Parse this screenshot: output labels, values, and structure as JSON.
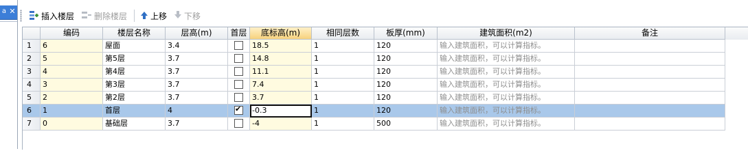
{
  "left_panel": {
    "tab_text": "a",
    "close_glyph": "✕"
  },
  "toolbar": {
    "insert_label": "插入楼层",
    "delete_label": "删除楼层",
    "up_label": "上移",
    "down_label": "下移"
  },
  "columns": [
    "",
    "编码",
    "楼层名称",
    "层高(m)",
    "首层",
    "底标高(m)",
    "相同层数",
    "板厚(mm)",
    "建筑面积(m2)",
    "备注"
  ],
  "rows": [
    {
      "num": "1",
      "code": "6",
      "name": "屋面",
      "height": "3.4",
      "first": false,
      "elev": "18.5",
      "same": "1",
      "thick": "120",
      "area": "输入建筑面积，可以计算指标。",
      "note": ""
    },
    {
      "num": "2",
      "code": "5",
      "name": "第5层",
      "height": "3.7",
      "first": false,
      "elev": "14.8",
      "same": "1",
      "thick": "120",
      "area": "输入建筑面积，可以计算指标。",
      "note": ""
    },
    {
      "num": "3",
      "code": "4",
      "name": "第4层",
      "height": "3.7",
      "first": false,
      "elev": "11.1",
      "same": "1",
      "thick": "120",
      "area": "输入建筑面积，可以计算指标。",
      "note": ""
    },
    {
      "num": "4",
      "code": "3",
      "name": "第3层",
      "height": "3.7",
      "first": false,
      "elev": "7.4",
      "same": "1",
      "thick": "120",
      "area": "输入建筑面积，可以计算指标。",
      "note": ""
    },
    {
      "num": "5",
      "code": "2",
      "name": "第2层",
      "height": "3.7",
      "first": false,
      "elev": "3.7",
      "same": "1",
      "thick": "120",
      "area": "输入建筑面积，可以计算指标。",
      "note": ""
    },
    {
      "num": "6",
      "code": "1",
      "name": "首层",
      "height": "4",
      "first": true,
      "elev": "-0.3",
      "same": "1",
      "thick": "120",
      "area": "输入建筑面积，可以计算指标。",
      "note": ""
    },
    {
      "num": "7",
      "code": "0",
      "name": "基础层",
      "height": "3.7",
      "first": false,
      "elev": "-4",
      "same": "1",
      "thick": "500",
      "area": "输入建筑面积，可以计算指标。",
      "note": ""
    }
  ],
  "selected_row": 5,
  "colors": {
    "selection": "#a9c8ea",
    "active_header": "#f7d27d",
    "editable_yellow": "#fffbe0"
  }
}
